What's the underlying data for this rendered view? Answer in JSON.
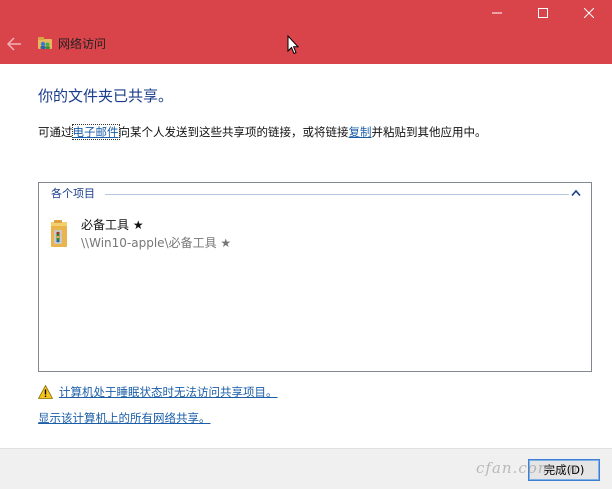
{
  "window": {
    "title": "网络访问",
    "controls": [
      "minimize-icon",
      "maximize-icon",
      "close-icon"
    ],
    "accent_color": "#d9434a"
  },
  "main": {
    "heading": "你的文件夹已共享。",
    "description": {
      "prefix": "可通过",
      "email_link": "电子邮件",
      "middle": "向某个人发送到这些共享项的链接，或将链接",
      "copy_link": "复制",
      "suffix": "并粘贴到其他应用中。"
    },
    "list": {
      "group_header": "各个项目",
      "items": [
        {
          "name": "必备工具 ★",
          "path": "\\\\Win10-apple\\必备工具 ★"
        }
      ]
    },
    "warning_link": "计算机处于睡眠状态时无法访问共享项目。",
    "show_all_link": "显示该计算机上的所有网络共享。"
  },
  "footer": {
    "done_button": "完成(D)"
  },
  "watermark": "cfan.com.cn"
}
